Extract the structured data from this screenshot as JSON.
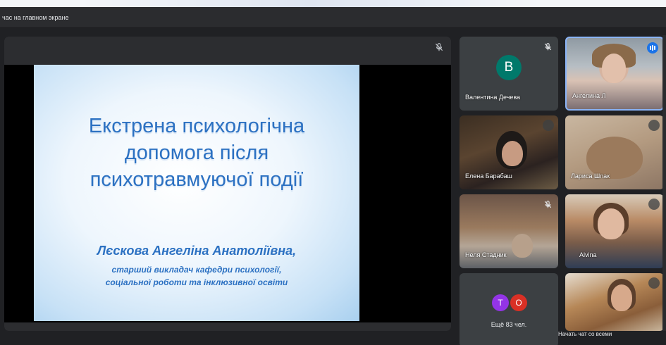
{
  "presenting_bar": {
    "text": "час на главном экране"
  },
  "slide": {
    "title_lines": [
      "Екстрена психологічна",
      "допомога після",
      "психотравмуючої події"
    ],
    "author": "Лєскова Ангеліна Анатоліївна,",
    "subtitle_lines": [
      "старший викладач кафедри психології,",
      "соціальної роботи та інклюзивної освіти"
    ]
  },
  "participants": [
    {
      "name": "Валентина Дечева",
      "avatar_letter": "В",
      "avatar_color": "#00796b",
      "muted": true
    },
    {
      "name": "Ангелина Л",
      "speaking": true
    },
    {
      "name": "Елена Барабаш",
      "muted": true
    },
    {
      "name": "Лариса Шпак",
      "muted": true
    },
    {
      "name": "Неля Стадник",
      "muted": true
    },
    {
      "name": "Alvina",
      "muted": true
    }
  ],
  "more_tile": {
    "avatars": [
      {
        "letter": "Т",
        "color": "#9334e6"
      },
      {
        "letter": "О",
        "color": "#d93025"
      }
    ],
    "count_label": "Ещё 83 чел."
  },
  "chat_hint": "Начать чат со всеми",
  "icons": [
    "mic-off-icon",
    "speaking-indicator-icon"
  ]
}
